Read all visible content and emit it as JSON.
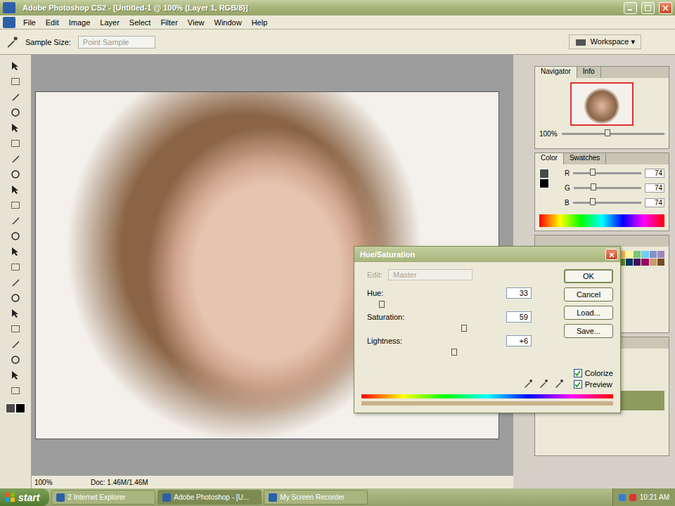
{
  "window": {
    "title": "Adobe Photoshop CS2 - [Untitled-1 @ 100% (Layer 1, RGB/8)]"
  },
  "menu": [
    "File",
    "Edit",
    "Image",
    "Layer",
    "Select",
    "Filter",
    "View",
    "Window",
    "Help"
  ],
  "options_bar": {
    "sample_label": "Sample Size:",
    "sample_value": "Point Sample",
    "sample_disabled": true,
    "workspace": "Workspace ▾"
  },
  "document": {
    "zoom": "100%",
    "doc_info": "Doc: 1.46M/1.46M"
  },
  "navigator": {
    "tabs": [
      {
        "label": "Navigator",
        "selected": true
      },
      {
        "label": "Info",
        "selected": false
      }
    ],
    "zoom": "100%",
    "level": 0.45
  },
  "color_panel": {
    "tabs": [
      {
        "label": "Color",
        "selected": true
      },
      {
        "label": "Swatches",
        "selected": false
      }
    ],
    "foreground": "#4a4a4a",
    "background": "#000000",
    "channels": [
      {
        "name": "R",
        "value": "74",
        "level": 0.29
      },
      {
        "name": "G",
        "value": "74",
        "level": 0.29
      },
      {
        "name": "B",
        "value": "74",
        "level": 0.29
      }
    ]
  },
  "swatches": [
    "#000000",
    "#3b3b3b",
    "#ff0000",
    "#ffff00",
    "#00ff00",
    "#00ffff",
    "#0000ff",
    "#ff00ff",
    "#f26c4f",
    "#f7977a",
    "#fbaf5d",
    "#fff79a",
    "#7cc576",
    "#6dcff6",
    "#8393ca",
    "#a187be",
    "#9e0b0f",
    "#a0410d",
    "#aba000",
    "#197b30",
    "#005e20",
    "#0076a3",
    "#0d004c",
    "#630460",
    "#790000",
    "#7b2e00",
    "#598527",
    "#003663",
    "#440e62",
    "#9e005d",
    "#c69c6d",
    "#754c24"
  ],
  "dialog": {
    "title": "Hue/Saturation",
    "close": "×",
    "edit_label": "Edit:",
    "edit_value": "Master",
    "edit_disabled": true,
    "sliders": [
      {
        "label": "Hue:",
        "value": "33",
        "level": 0.09
      },
      {
        "label": "Saturation:",
        "value": "59",
        "level": 0.59
      },
      {
        "label": "Lightness:",
        "value": "+6",
        "level": 0.53
      }
    ],
    "buttons": [
      {
        "label": "OK",
        "default": true
      },
      {
        "label": "Cancel",
        "default": false
      },
      {
        "label": "Load...",
        "default": false
      },
      {
        "label": "Save...",
        "default": false
      }
    ],
    "checkboxes": [
      {
        "label": "Colorize",
        "checked": true
      },
      {
        "label": "Preview",
        "checked": true
      }
    ],
    "result_color": "#c9b28a"
  },
  "taskbar": {
    "start": "start",
    "items": [
      {
        "label": "2 Internet Explorer",
        "selected": false
      },
      {
        "label": "Adobe Photoshop - [U...",
        "selected": true
      },
      {
        "label": "My Screen Recorder",
        "selected": false
      }
    ],
    "time": "10:21 AM"
  }
}
